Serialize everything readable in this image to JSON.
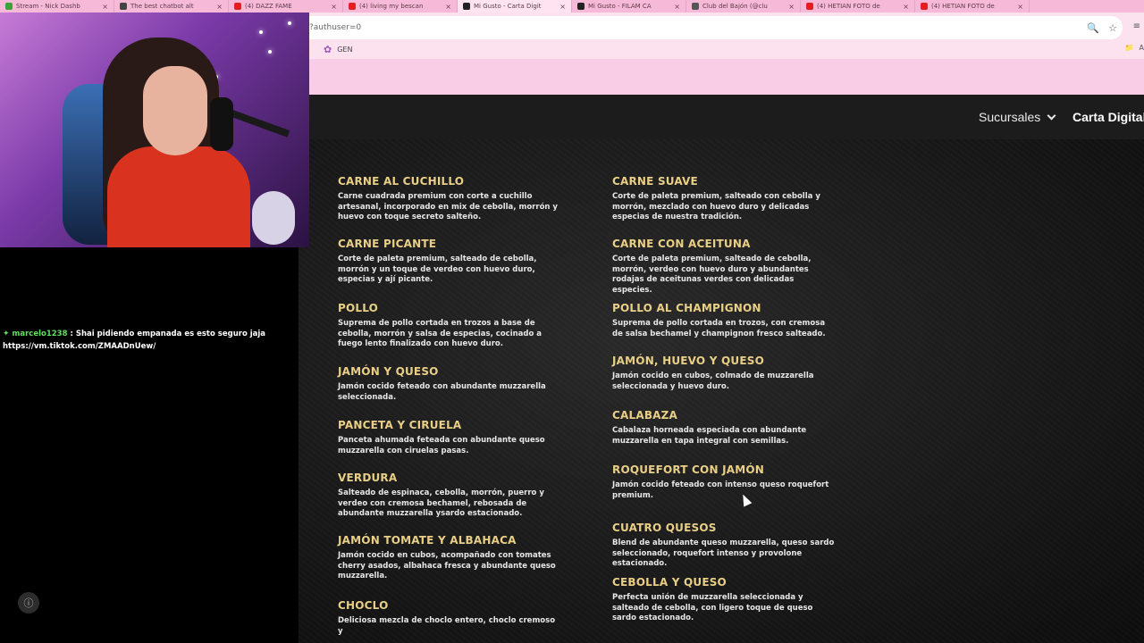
{
  "browser": {
    "tabs": [
      {
        "title": "Stream - Nick Dashb",
        "favicon_color": "#3aa33a",
        "active": false
      },
      {
        "title": "The best chatbot alt",
        "favicon_color": "#444444",
        "active": false
      },
      {
        "title": "(4) DAZZ FAME",
        "favicon_color": "#e02020",
        "active": false
      },
      {
        "title": "(4) living my bescan",
        "favicon_color": "#e02020",
        "active": false
      },
      {
        "title": "Mi Gusto - Carta Digit",
        "favicon_color": "#222222",
        "active": true
      },
      {
        "title": "Mi Gusto - FILAM CA",
        "favicon_color": "#222222",
        "active": false
      },
      {
        "title": "Club del Bajón (@clu",
        "favicon_color": "#555555",
        "active": false
      },
      {
        "title": "(4) HETIAN FOTO de",
        "favicon_color": "#e02020",
        "active": false
      },
      {
        "title": "(4) HETIAN FOTO de",
        "favicon_color": "#e02020",
        "active": false
      }
    ],
    "url": "?authuser=0",
    "bookmark": "GEN",
    "bookmarks_right": "A"
  },
  "site": {
    "nav_sucursales": "Sucursales",
    "nav_carta": "Carta Digital"
  },
  "menu": {
    "left": [
      {
        "name": "CARNE AL CUCHILLO",
        "desc": "Carne cuadrada premium con corte a cuchillo artesanal, incorporado en mix de cebolla, morrón y huevo con toque secreto salteño."
      },
      {
        "name": "CARNE PICANTE",
        "desc": "Corte de paleta premium, salteado de cebolla, morrón y un toque de verdeo con huevo duro, especias y ají picante."
      },
      {
        "name": "POLLO",
        "desc": "Suprema de pollo cortada en trozos a base de cebolla, morrón y salsa de especias, cocinado a fuego lento finalizado con huevo duro."
      },
      {
        "name": "JAMÓN Y QUESO",
        "desc": "Jamón cocido feteado con abundante muzzarella seleccionada."
      },
      {
        "name": "PANCETA Y CIRUELA",
        "desc": "Panceta ahumada feteada con abundante queso muzzarella con ciruelas pasas."
      },
      {
        "name": "VERDURA",
        "desc": "Salteado de espinaca, cebolla, morrón, puerro y verdeo con cremosa bechamel, rebosada de abundante muzzarella ysardo estacionado."
      },
      {
        "name": "JAMÓN  TOMATE Y ALBAHACA",
        "desc": "Jamón cocido en cubos, acompañado con tomates cherry asados, albahaca fresca y abundante queso muzzarella."
      },
      {
        "name": "CHOCLO",
        "desc": "Deliciosa mezcla de choclo entero, choclo cremoso y"
      }
    ],
    "right": [
      {
        "name": "CARNE SUAVE",
        "desc": "Corte de paleta premium, salteado con cebolla y morrón, mezclado con huevo duro y delicadas especias de nuestra tradición."
      },
      {
        "name": "CARNE CON ACEITUNA",
        "desc": "Corte de paleta premium, salteado de cebolla, morrón, verdeo con huevo duro y abundantes rodajas de aceitunas verdes con delicadas especies."
      },
      {
        "name": "POLLO AL CHAMPIGNON",
        "desc": "Suprema de pollo cortada en trozos, con cremosa de salsa bechamel y champignon fresco salteado."
      },
      {
        "name": "JAMÓN, HUEVO Y QUESO",
        "desc": "Jamón cocido en cubos, colmado de muzzarella seleccionada y huevo duro."
      },
      {
        "name": "CALABAZA",
        "desc": "Cabalaza horneada especiada con abundante muzzarella en tapa integral con semillas."
      },
      {
        "name": "ROQUEFORT CON JAMÓN",
        "desc": "Jamón cocido feteado con intenso queso roquefort premium."
      },
      {
        "name": "CUATRO QUESOS",
        "desc": "Blend de abundante queso muzzarella, queso sardo seleccionado, roquefort intenso y provolone estacionado."
      },
      {
        "name": "CEBOLLA Y QUESO",
        "desc": "Perfecta unión de muzzarella seleccionada y salteado de cebolla, con ligero toque de queso sardo estacionado."
      }
    ]
  },
  "chat": {
    "username": "marcelo1238",
    "message": ": Shai pidiendo empanada es esto seguro jaja",
    "link": "https://vm.tiktok.com/ZMAADnUew/"
  },
  "colors": {
    "item_title": "#e9cf86",
    "browser_pink": "#f9cde6",
    "chat_user": "#5de05a"
  },
  "icons": {
    "zoom": "magnifier-icon",
    "bookmark_star": "star-icon",
    "info": "info-icon"
  }
}
